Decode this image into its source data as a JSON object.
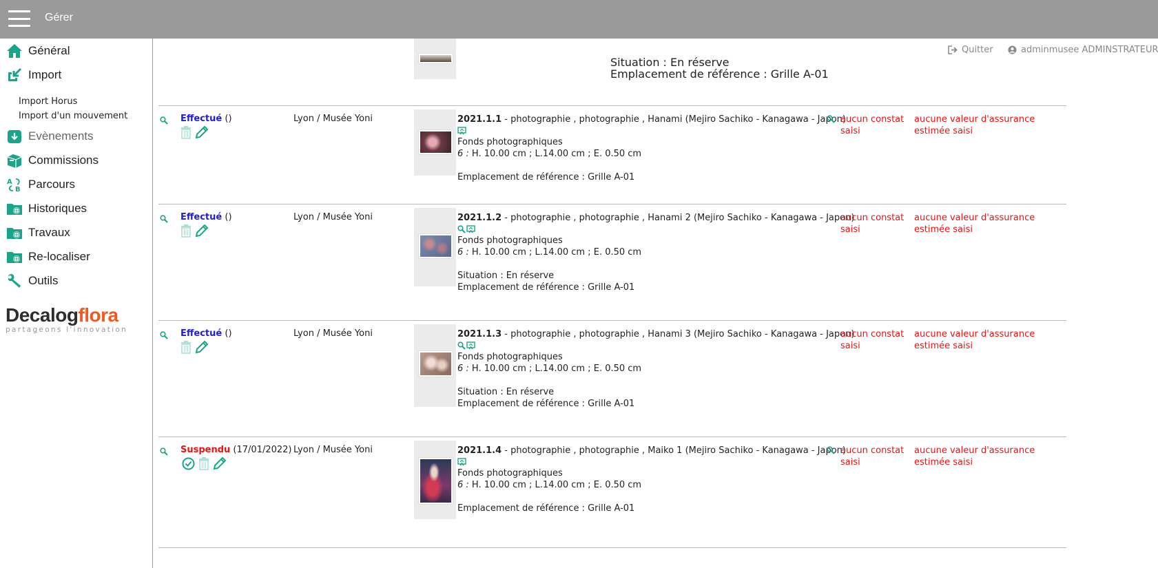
{
  "topbar": {
    "title": "Gérer"
  },
  "sidebar": {
    "items": [
      {
        "label": "Général",
        "icon": "home-icon"
      },
      {
        "label": "Import",
        "icon": "import-icon"
      },
      {
        "label": "Evènements",
        "icon": "events-icon"
      },
      {
        "label": "Commissions",
        "icon": "commissions-icon"
      },
      {
        "label": "Parcours",
        "icon": "parcours-icon"
      },
      {
        "label": "Historiques",
        "icon": "historiques-icon"
      },
      {
        "label": "Travaux",
        "icon": "travaux-icon"
      },
      {
        "label": "Re-localiser",
        "icon": "relocaliser-icon"
      },
      {
        "label": "Outils",
        "icon": "wrench-icon"
      }
    ],
    "import_sub": [
      "Import Horus",
      "Import d'un mouvement"
    ],
    "logo": {
      "part1": "Decalog",
      "part2": "flora",
      "tagline": "partageons l'innovation"
    }
  },
  "header": {
    "quit": "Quitter",
    "user": "adminmusee ADMINSTRATEUR"
  },
  "partial_row": {
    "situation": "Situation : En réserve",
    "emplacement": "Emplacement de référence : Grille A-01"
  },
  "rows": [
    {
      "status": "Effectué",
      "date": "()",
      "place": "Lyon / Musée Yoni",
      "inv": "2021.1.1",
      "title": " - photographie , photographie , Hanami (Mejiro Sachiko - Kanagawa - Japon)",
      "fonds": "Fonds photographiques",
      "dim_prefix": "6 :",
      "dims": " H. 10.00 cm ; L.14.00 cm ; E. 0.50 cm",
      "situation": "",
      "emplacement": "Emplacement de référence : Grille A-01",
      "constat": "aucun constat saisi",
      "assurance": "aucune valeur d'assurance estimée saisi"
    },
    {
      "status": "Effectué",
      "date": "()",
      "place": "Lyon / Musée Yoni",
      "inv": "2021.1.2",
      "title": " - photographie , photographie , Hanami 2 (Mejiro Sachiko - Kanagawa - Japon)",
      "fonds": "Fonds photographiques",
      "dim_prefix": "6 :",
      "dims": " H. 10.00 cm ; L.14.00 cm ; E. 0.50 cm",
      "situation": "Situation : En réserve",
      "emplacement": "Emplacement de référence : Grille A-01",
      "constat": "aucun constat saisi",
      "assurance": "aucune valeur d'assurance estimée saisi"
    },
    {
      "status": "Effectué",
      "date": "()",
      "place": "Lyon / Musée Yoni",
      "inv": "2021.1.3",
      "title": " - photographie , photographie , Hanami 3 (Mejiro Sachiko - Kanagawa - Japon)",
      "fonds": "Fonds photographiques",
      "dim_prefix": "6 :",
      "dims": " H. 10.00 cm ; L.14.00 cm ; E. 0.50 cm",
      "situation": "Situation : En réserve",
      "emplacement": "Emplacement de référence : Grille A-01",
      "constat": "aucun constat saisi",
      "assurance": "aucune valeur d'assurance estimée saisi"
    },
    {
      "status": "Suspendu",
      "date": " (17/01/2022)",
      "place": "Lyon / Musée Yoni",
      "inv": "2021.1.4",
      "title": " - photographie , photographie , Maiko 1 (Mejiro Sachiko - Kanagawa - Japon)",
      "fonds": "Fonds photographiques",
      "dim_prefix": "6 :",
      "dims": " H. 10.00 cm ; L.14.00 cm ; E. 0.50 cm",
      "situation": "",
      "emplacement": "Emplacement de référence : Grille A-01",
      "constat": "aucun constat saisi",
      "assurance": "aucune valeur d'assurance estimée saisi"
    }
  ],
  "colors": {
    "accent": "#1aa58a",
    "status_ok": "#1d1ddb",
    "status_suspended": "#e11111",
    "warning": "#e11111",
    "topbar": "#9a9a9a"
  }
}
